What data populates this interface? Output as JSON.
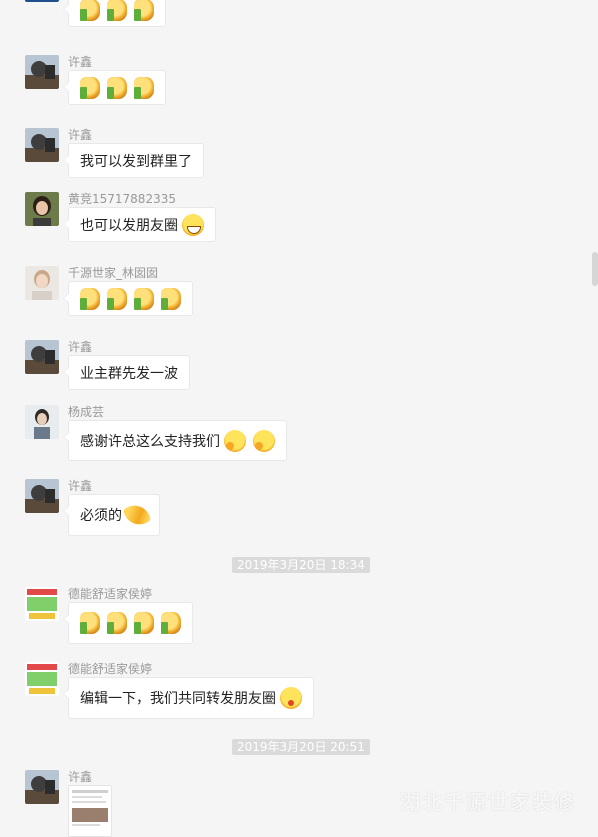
{
  "messages": [
    {
      "type": "emoji",
      "sender": "",
      "emojis": [
        "thumbs-up",
        "thumbs-up",
        "thumbs-up"
      ]
    },
    {
      "type": "emoji",
      "sender": "许鑫",
      "emojis": [
        "thumbs-up",
        "thumbs-up",
        "thumbs-up"
      ]
    },
    {
      "type": "text",
      "sender": "许鑫",
      "text": "我可以发到群里了"
    },
    {
      "type": "text",
      "sender": "黄竞15717882335",
      "text": "也可以发朋友圈",
      "emojis": [
        "grinning-face"
      ]
    },
    {
      "type": "emoji",
      "sender": "千源世家_林囡囡",
      "emojis": [
        "thumbs-up",
        "thumbs-up",
        "thumbs-up",
        "thumbs-up"
      ]
    },
    {
      "type": "text",
      "sender": "许鑫",
      "text": "业主群先发一波"
    },
    {
      "type": "text",
      "sender": "杨成芸",
      "text": "感谢许总这么支持我们",
      "emojis": [
        "thinking-face",
        "thinking-face"
      ]
    },
    {
      "type": "text",
      "sender": "许鑫",
      "text": "必须的",
      "emojis": [
        "waving-hand"
      ]
    },
    {
      "type": "timestamp",
      "text": "2019年3月20日 18:34"
    },
    {
      "type": "emoji",
      "sender": "德能舒适家侯婷",
      "emojis": [
        "thumbs-up",
        "thumbs-up",
        "thumbs-up",
        "thumbs-up"
      ]
    },
    {
      "type": "text",
      "sender": "德能舒适家侯婷",
      "text": "编辑一下，我们共同转发朋友圈",
      "emojis": [
        "winking-tongue-face"
      ]
    },
    {
      "type": "timestamp",
      "text": "2019年3月20日 20:51"
    },
    {
      "type": "image",
      "sender": "许鑫"
    }
  ],
  "watermark": "湖北千源世家装修",
  "watermark_sub": "",
  "colors": {
    "background": "#f5f5f5",
    "bubble": "#ffffff",
    "timestamp_bg": "#dadada",
    "sender_text": "#999999"
  }
}
